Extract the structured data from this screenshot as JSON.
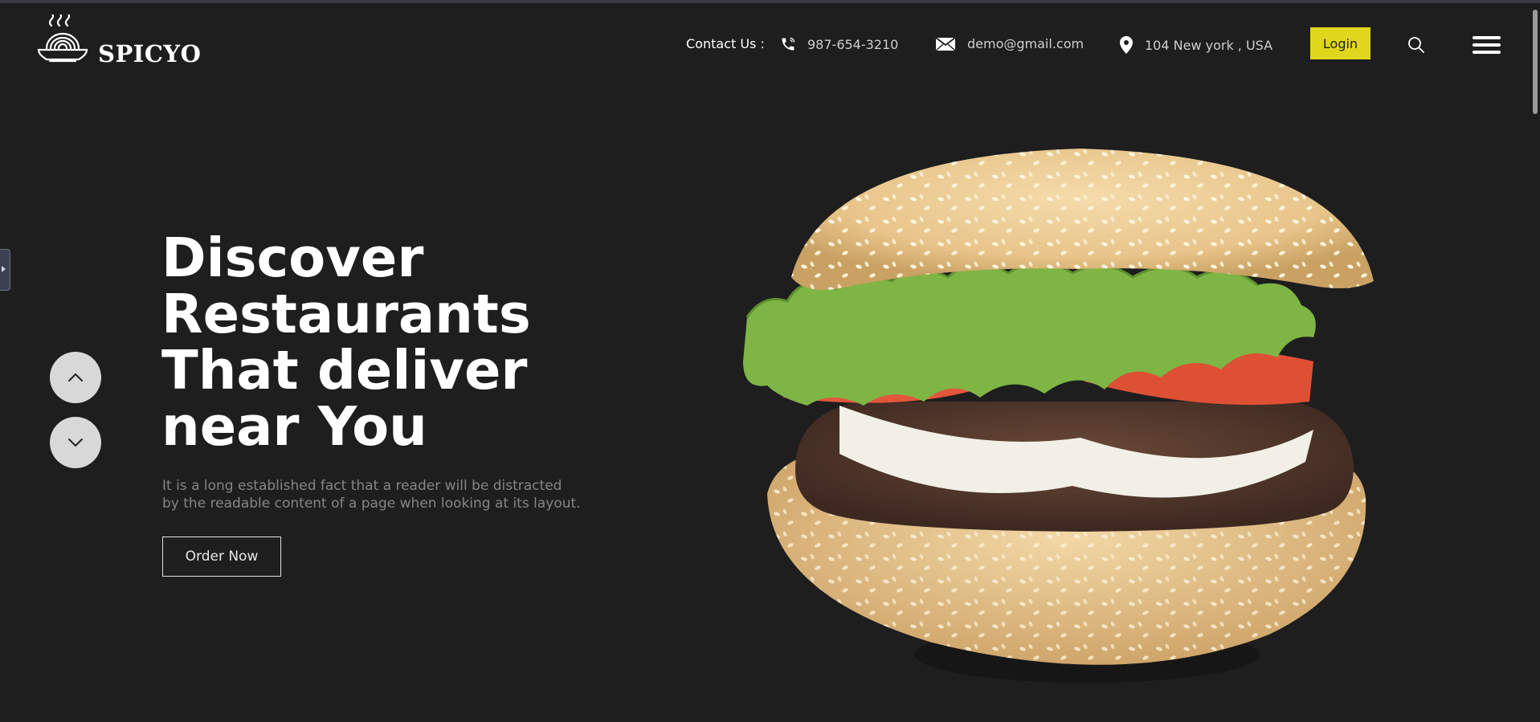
{
  "brand": {
    "name": "SPICYO",
    "logo_icon": "noodle-bowl-icon"
  },
  "header": {
    "contact_label": "Contact Us :",
    "phone": {
      "icon": "phone-icon",
      "text": "987-654-3210"
    },
    "email": {
      "icon": "mail-icon",
      "text": "demo@gmail.com"
    },
    "location": {
      "icon": "location-pin-icon",
      "text": "104 New york , USA"
    },
    "login_label": "Login",
    "search_icon": "search-icon",
    "menu_icon": "hamburger-menu-icon"
  },
  "hero": {
    "title_lines": [
      "Discover",
      "Restaurants",
      "That deliver",
      "near You"
    ],
    "description_lines": [
      "It is a long established fact that a reader will be distracted",
      "by the readable content of a page when looking at its layout."
    ],
    "order_button": "Order Now",
    "prev_icon": "chevron-up-icon",
    "next_icon": "chevron-down-icon",
    "image": "burger-image"
  },
  "colors": {
    "background": "#1e1e1f",
    "accent": "#e0d61d",
    "text": "#ffffff",
    "muted": "#858585"
  }
}
